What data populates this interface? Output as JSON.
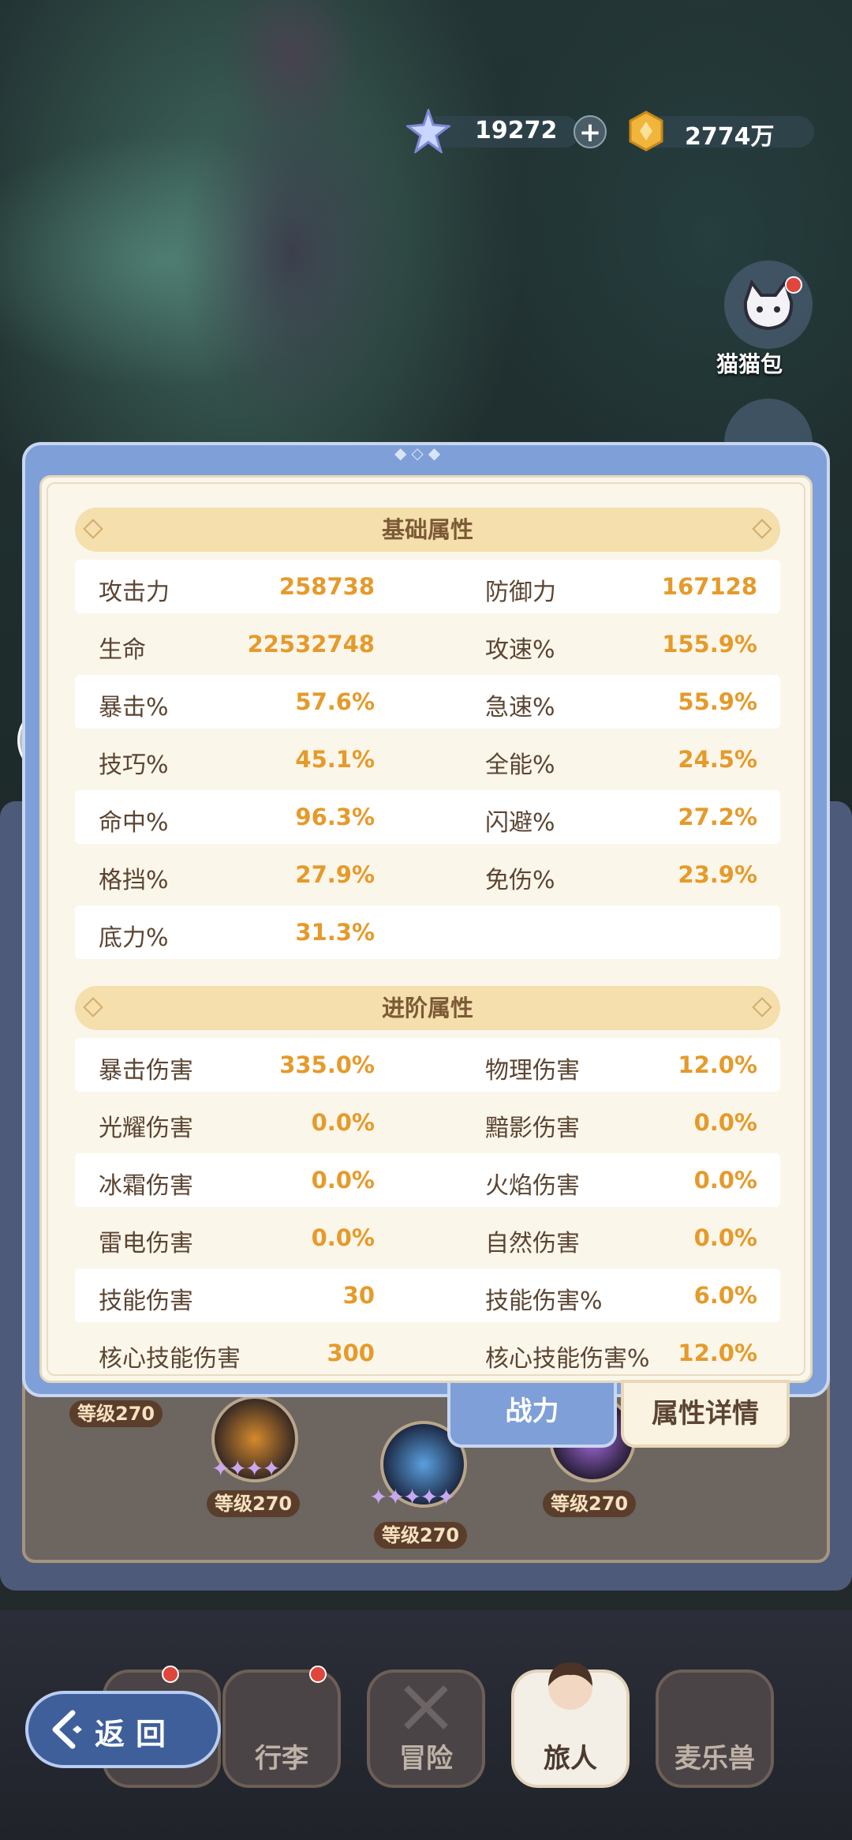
{
  "currency": {
    "diamonds": "19272",
    "gold": "2774万"
  },
  "side": {
    "cat_bag_label": "猫猫包"
  },
  "panel": {
    "basic_title": "基础属性",
    "advanced_title": "进阶属性",
    "basic_rows": [
      {
        "l1": "攻击力",
        "v1": "258738",
        "l2": "防御力",
        "v2": "167128"
      },
      {
        "l1": "生命",
        "v1": "22532748",
        "l2": "攻速%",
        "v2": "155.9%"
      },
      {
        "l1": "暴击%",
        "v1": "57.6%",
        "l2": "急速%",
        "v2": "55.9%"
      },
      {
        "l1": "技巧%",
        "v1": "45.1%",
        "l2": "全能%",
        "v2": "24.5%"
      },
      {
        "l1": "命中%",
        "v1": "96.3%",
        "l2": "闪避%",
        "v2": "27.2%"
      },
      {
        "l1": "格挡%",
        "v1": "27.9%",
        "l2": "免伤%",
        "v2": "23.9%"
      },
      {
        "l1": "底力%",
        "v1": "31.3%",
        "l2": "",
        "v2": ""
      }
    ],
    "advanced_rows": [
      {
        "l1": "暴击伤害",
        "v1": "335.0%",
        "l2": "物理伤害",
        "v2": "12.0%"
      },
      {
        "l1": "光耀伤害",
        "v1": "0.0%",
        "l2": "黯影伤害",
        "v2": "0.0%"
      },
      {
        "l1": "冰霜伤害",
        "v1": "0.0%",
        "l2": "火焰伤害",
        "v2": "0.0%"
      },
      {
        "l1": "雷电伤害",
        "v1": "0.0%",
        "l2": "自然伤害",
        "v2": "0.0%"
      },
      {
        "l1": "技能伤害",
        "v1": "30",
        "l2": "技能伤害%",
        "v2": "6.0%"
      },
      {
        "l1": "核心技能伤害",
        "v1": "300",
        "l2": "核心技能伤害%",
        "v2": "12.0%"
      }
    ]
  },
  "tabs": {
    "power": "战力",
    "details": "属性详情"
  },
  "skills": {
    "level_1": "等级270",
    "level_2": "等级270",
    "level_3": "等级270",
    "level_4": "等级270"
  },
  "nav": {
    "back": "返回",
    "items": [
      "行李",
      "冒险",
      "旅人",
      "麦乐兽"
    ]
  },
  "colors": {
    "accent_value": "#e69a2a",
    "panel_blue": "#7f9fd9",
    "panel_cream": "#fbf6ea",
    "header_gold": "#f4dfad"
  }
}
